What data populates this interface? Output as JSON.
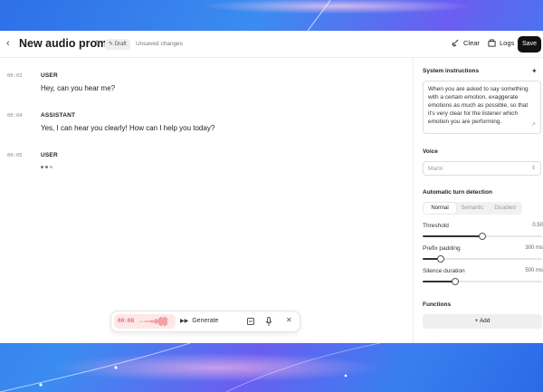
{
  "header": {
    "back_icon": "chevron-left-icon",
    "title": "New audio prompt",
    "badge": "Draft",
    "status": "Unsaved changes",
    "clear_label": "Clear",
    "logs_label": "Logs",
    "save_label": "Save"
  },
  "conversation": [
    {
      "time": "00:02",
      "role": "USER",
      "text": "Hey, can you hear me?"
    },
    {
      "time": "00:04",
      "role": "ASSISTANT",
      "text": "Yes, I can hear you clearly! How can I help you today?"
    },
    {
      "time": "00:05",
      "role": "USER",
      "text": ""
    }
  ],
  "composer": {
    "timer": "00:08",
    "generate_label": "Generate",
    "icons": [
      "waveform-icon",
      "sparkle-icon",
      "text-input-icon",
      "microphone-icon",
      "close-icon"
    ]
  },
  "sidebar": {
    "system_instructions_label": "System instructions",
    "system_instructions_text": "When you are asked to say something with a certain emotion, exaggerate emotions as much as possible, so that it's very clear for the listener which emotion you are performing.",
    "voice_label": "Voice",
    "voice_value": "Marin",
    "turn_detection_label": "Automatic turn detection",
    "turn_modes": [
      "Normal",
      "Semantic",
      "Disabled"
    ],
    "selected_turn_mode": "Normal",
    "threshold_label": "Threshold",
    "threshold_value": "0.50",
    "threshold_level": 0.5,
    "prefix_padding_label": "Prefix padding",
    "prefix_padding_value": "300 ms",
    "prefix_padding_level": 0.15,
    "silence_duration_label": "Silence duration",
    "silence_duration_value": "500 ms",
    "silence_duration_level": 0.27,
    "functions_label": "Functions",
    "add_label": "+ Add"
  },
  "colors": {
    "accent_dark": "#111111",
    "recording_red": "#e03a3a",
    "background_blue": "#3b8cf0"
  }
}
